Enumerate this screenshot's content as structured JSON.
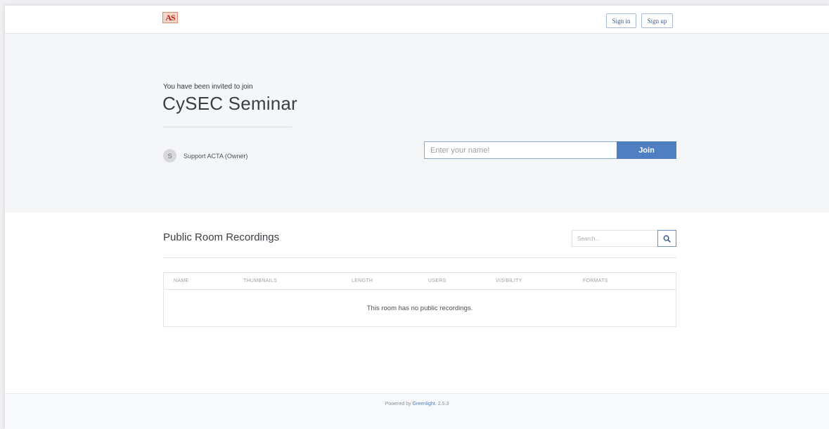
{
  "header": {
    "logo_text": "AS",
    "sign_in_label": "Sign in",
    "sign_up_label": "Sign up"
  },
  "invite": {
    "label": "You have been invited to join",
    "room_name": "CySEC Seminar",
    "owner_initial": "S",
    "owner_name": "Support ACTA (Owner)",
    "name_placeholder": "Enter your name!",
    "join_label": "Join"
  },
  "recordings": {
    "title": "Public Room Recordings",
    "search_placeholder": "Search...",
    "columns": [
      "NAME",
      "THUMBNAILS",
      "LENGTH",
      "USERS",
      "VISIBILITY",
      "FORMATS"
    ],
    "empty_message": "This room has no public recordings."
  },
  "footer": {
    "prefix": "Powered by ",
    "link_text": "Greenlight",
    "version": ". 2.5.3"
  },
  "colors": {
    "accent": "#4f7fc2",
    "hero_bg": "#f5f6f8"
  },
  "icons": {
    "search": "search-icon"
  }
}
